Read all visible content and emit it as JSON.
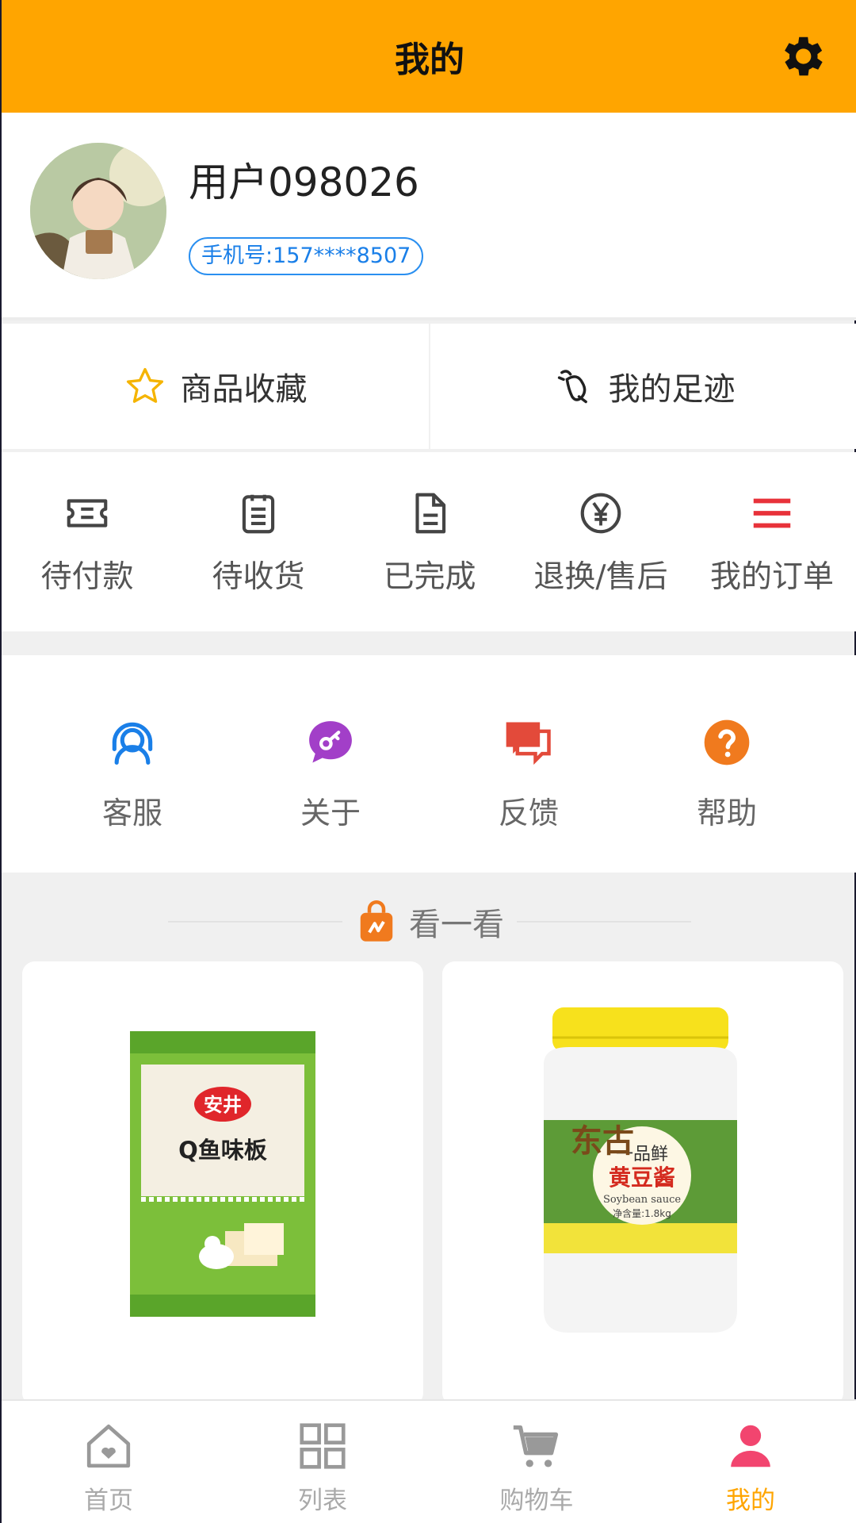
{
  "header": {
    "title": "我的"
  },
  "profile": {
    "username": "用户098026",
    "phone": "手机号:157****8507"
  },
  "quick": [
    {
      "label": "商品收藏",
      "icon": "star-icon"
    },
    {
      "label": "我的足迹",
      "icon": "footprint-icon"
    }
  ],
  "orders": [
    {
      "label": "待付款",
      "icon": "ticket-icon"
    },
    {
      "label": "待收货",
      "icon": "clipboard-icon"
    },
    {
      "label": "已完成",
      "icon": "document-icon"
    },
    {
      "label": "退换/售后",
      "icon": "yen-icon"
    },
    {
      "label": "我的订单",
      "icon": "menu-icon"
    }
  ],
  "services": [
    {
      "label": "客服",
      "icon": "headset-icon"
    },
    {
      "label": "关于",
      "icon": "chat-key-icon"
    },
    {
      "label": "反馈",
      "icon": "speech-bubbles-icon"
    },
    {
      "label": "帮助",
      "icon": "question-icon"
    }
  ],
  "section": {
    "title": "看一看"
  },
  "products": [
    {
      "brand": "安井",
      "name": "Q鱼味板"
    },
    {
      "brand": "东古",
      "name": "黄豆酱",
      "tagline": "一品鲜",
      "en": "Soybean sauce",
      "weight": "净含量:1.8kg"
    }
  ],
  "tabbar": [
    {
      "label": "首页",
      "icon": "home-icon"
    },
    {
      "label": "列表",
      "icon": "grid-icon"
    },
    {
      "label": "购物车",
      "icon": "cart-icon"
    },
    {
      "label": "我的",
      "icon": "person-icon",
      "active": true
    }
  ],
  "colors": {
    "accent": "#ffa500",
    "blue": "#1a7fe8",
    "purple": "#a23fc8",
    "red": "#e34a3a",
    "orange": "#f07a1e",
    "menu_red": "#e8323a",
    "pink": "#f2456f"
  }
}
